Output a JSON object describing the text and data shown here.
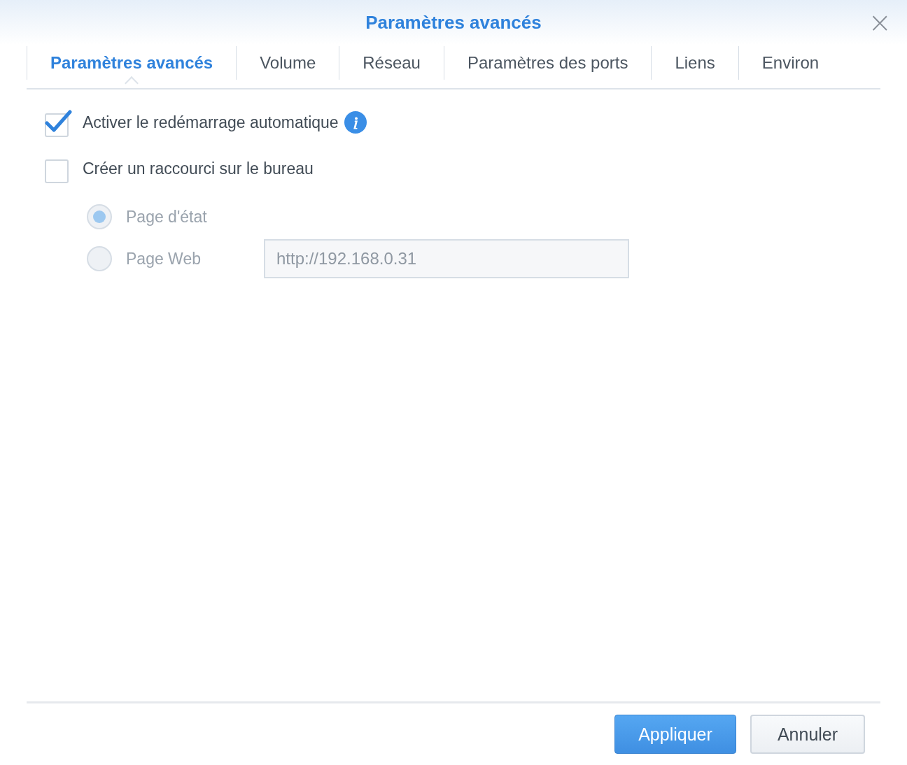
{
  "window": {
    "title": "Paramètres avancés",
    "close": "×"
  },
  "tabs": [
    {
      "label": "Paramètres avancés",
      "selected": true
    },
    {
      "label": "Volume",
      "selected": false
    },
    {
      "label": "Réseau",
      "selected": false
    },
    {
      "label": "Paramètres des ports",
      "selected": false
    },
    {
      "label": "Liens",
      "selected": false
    },
    {
      "label": "Environ",
      "selected": false
    }
  ],
  "options": [
    {
      "label": "Activer le redémarrage automatique",
      "checked": true,
      "info": true
    },
    {
      "label": "Créer un raccourci sur le bureau",
      "checked": false,
      "info": false
    }
  ],
  "shortcut_targets": [
    {
      "label": "Page d'état",
      "selected": true,
      "disabled": true
    },
    {
      "label": "Page Web",
      "selected": false,
      "disabled": true,
      "url": "http://192.168.0.31"
    }
  ],
  "buttons": [
    {
      "label": "Appliquer",
      "kind": "primary"
    },
    {
      "label": "Annuler",
      "kind": "secondary"
    }
  ]
}
